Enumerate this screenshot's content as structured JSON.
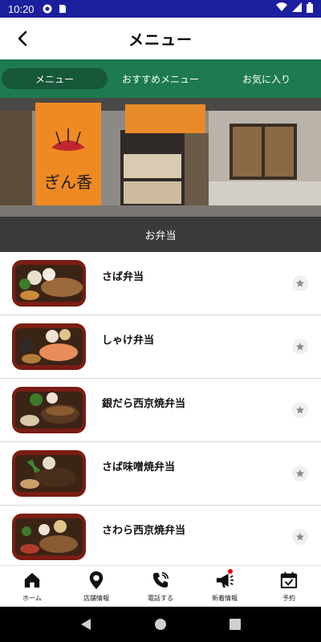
{
  "status_bar": {
    "time": "10:20"
  },
  "header": {
    "title": "メニュー"
  },
  "tabs": [
    {
      "label": "メニュー",
      "active": true
    },
    {
      "label": "おすすめメニュー",
      "active": false
    },
    {
      "label": "お気に入り",
      "active": false
    }
  ],
  "banner": {
    "shop_name": "ぎん香"
  },
  "category": {
    "label": "お弁当"
  },
  "menu_items": [
    {
      "name": "さば弁当"
    },
    {
      "name": "しゃけ弁当"
    },
    {
      "name": "銀だら西京焼弁当"
    },
    {
      "name": "さば味噌焼弁当"
    },
    {
      "name": "さわら西京焼弁当"
    }
  ],
  "bottom_nav": [
    {
      "label": "ホーム",
      "icon": "home-icon"
    },
    {
      "label": "店舗情報",
      "icon": "location-pin-icon"
    },
    {
      "label": "電話する",
      "icon": "phone-icon"
    },
    {
      "label": "新着情報",
      "icon": "megaphone-icon",
      "badge": true
    },
    {
      "label": "予約",
      "icon": "calendar-check-icon"
    }
  ],
  "colors": {
    "status_bar": "#1b1f9e",
    "tab_bar": "#1e7a50",
    "tab_active": "#17573a",
    "category_bar": "#3b3b3b",
    "badge": "#e60012"
  }
}
